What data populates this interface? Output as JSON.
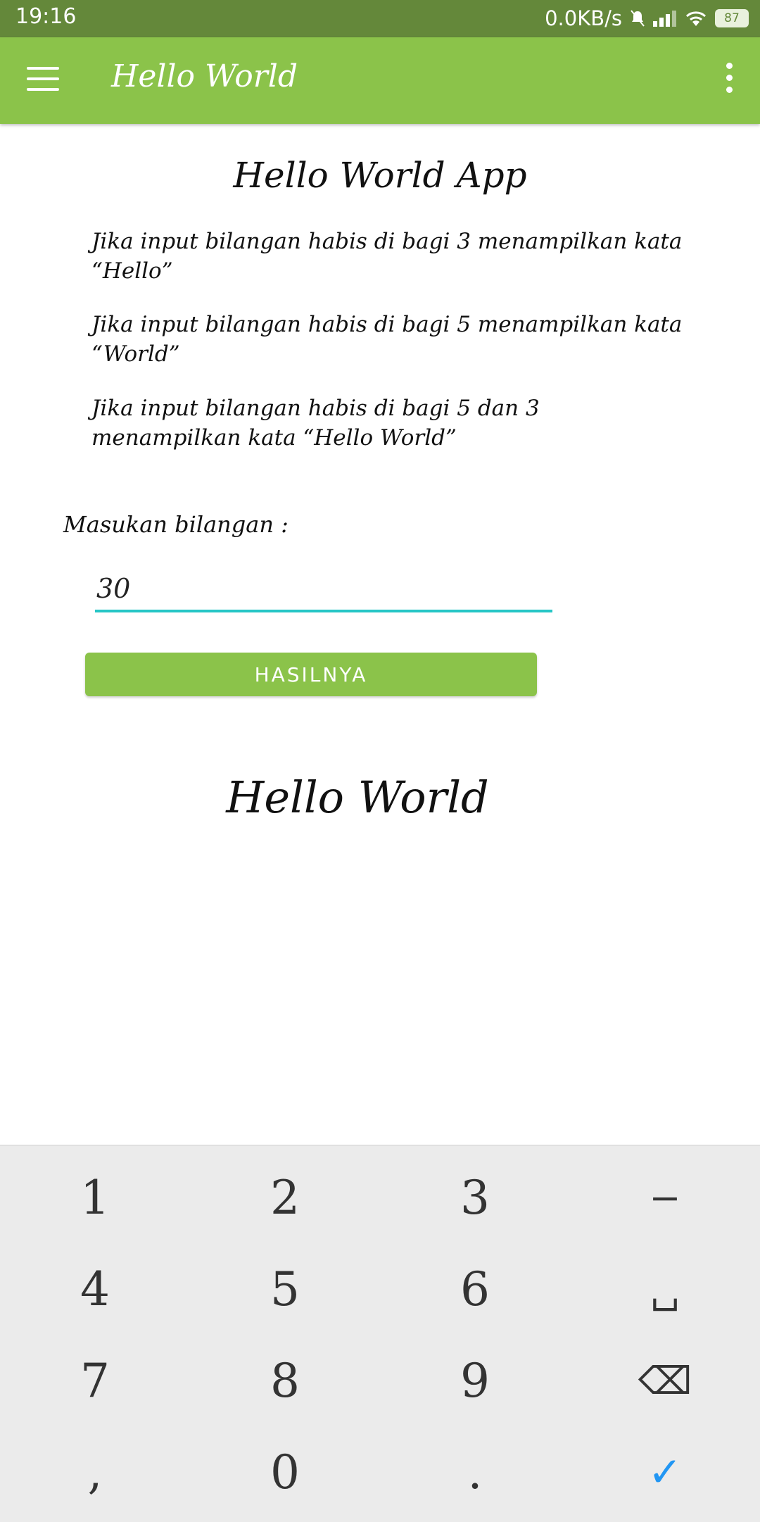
{
  "status": {
    "time": "19:16",
    "net_speed": "0.0KB/s",
    "battery": "87"
  },
  "appbar": {
    "title": "Hello World"
  },
  "main": {
    "title": "Hello World App",
    "rules": [
      "Jika input bilangan habis di bagi 3 menampilkan kata “Hello”",
      "Jika input bilangan habis di bagi 5 menampilkan kata “World”",
      "Jika input bilangan habis di bagi 5 dan 3 menampilkan kata “Hello World”"
    ],
    "input_label": "Masukan bilangan :",
    "input_value": "30",
    "button_label": "HASILNYA",
    "result": "Hello World"
  },
  "keyboard": {
    "keys": [
      "1",
      "2",
      "3",
      "−",
      "4",
      "5",
      "6",
      "␣",
      "7",
      "8",
      "9",
      "⌫",
      ",",
      "0",
      ".",
      "✓"
    ]
  }
}
